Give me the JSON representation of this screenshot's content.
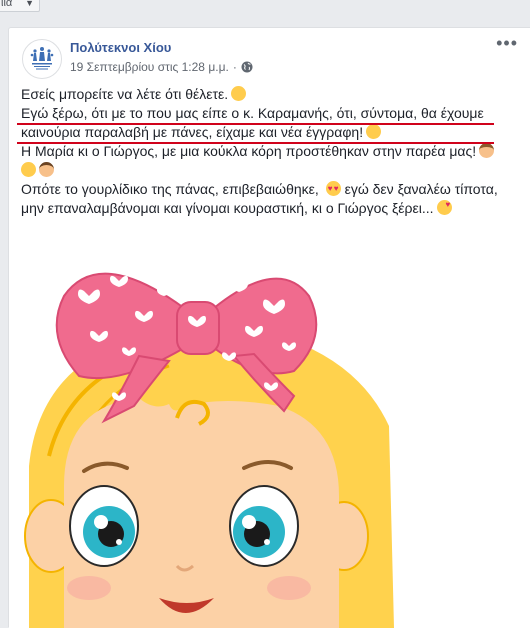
{
  "header_strip": {
    "language_select_value": "ιιὰ"
  },
  "post": {
    "page_name": "Πολύτεκνοι Χίου",
    "timestamp": "19 Σεπτεμβρίου στις 1:28 μ.μ.",
    "separator": "·",
    "privacy_icon": "globe-icon",
    "more_label": "•••",
    "lines": [
      {
        "text": "Εσείς μπορείτε να λέτε ότι θέλετε.",
        "emoji": [
          "thinking-face-emoji"
        ]
      },
      {
        "text": "Εγώ ξέρω, ότι με το που μας είπε ο κ. Καραμανής, ότι, σύντομα, θα έχουμε",
        "emoji": []
      },
      {
        "text": "καινούρια παραλαβή με πάνες, είχαμε και νέα έγγραφη!",
        "emoji": [
          "rofl-emoji"
        ]
      },
      {
        "text": "Η Μαρία κι ο Γιώργος, με μια κούκλα κόρη προστέθηκαν στην παρέα μας!",
        "emoji": [
          "woman-emoji"
        ]
      },
      {
        "text": "",
        "emoji": [
          "baby-emoji",
          "man-emoji"
        ]
      },
      {
        "text": "Οπότε το γουρλίδικο της πάνας, επιβεβαιώθηκε,",
        "text_after": "εγώ δεν ξαναλέω τίποτα,",
        "emoji": [
          "heart-eyes-emoji"
        ]
      },
      {
        "text": "μην επαναλαμβάνομαι και γίνομαι κουραστική, κι ο Γιώργος ξέρει...",
        "emoji": [
          "kissing-heart-emoji"
        ]
      }
    ]
  },
  "colors": {
    "page_name": "#385898",
    "text": "#1d2129",
    "meta": "#616770",
    "underline": "#d0021b",
    "bow_pink": "#f06b8e",
    "hair": "#ffd24d",
    "skin": "#fcd1a6",
    "eye": "#2cb5c8"
  }
}
